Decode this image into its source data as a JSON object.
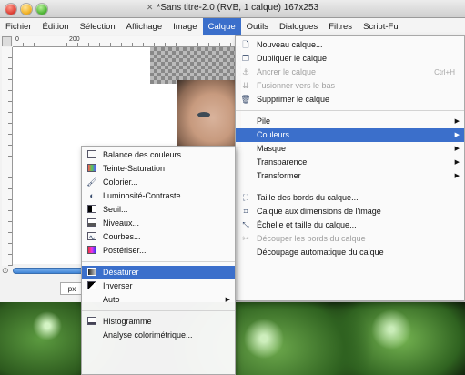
{
  "window": {
    "title": "*Sans titre-2.0 (RVB, 1 calque) 167x253",
    "title_icon": "gimp-wilber-icon"
  },
  "menubar": [
    {
      "label": "Fichier",
      "active": false
    },
    {
      "label": "Édition",
      "active": false
    },
    {
      "label": "Sélection",
      "active": false
    },
    {
      "label": "Affichage",
      "active": false
    },
    {
      "label": "Image",
      "active": false
    },
    {
      "label": "Calque",
      "active": true
    },
    {
      "label": "Outils",
      "active": false
    },
    {
      "label": "Dialogues",
      "active": false
    },
    {
      "label": "Filtres",
      "active": false
    },
    {
      "label": "Script-Fu",
      "active": false
    }
  ],
  "ruler": {
    "h_labels": [
      "0",
      "200"
    ]
  },
  "unit_selector": "px",
  "calque_menu": {
    "items": [
      {
        "label": "Nouveau calque...",
        "icon": "new-layer-icon",
        "disabled": false
      },
      {
        "label": "Dupliquer le calque",
        "icon": "duplicate-layer-icon",
        "disabled": false
      },
      {
        "label": "Ancrer le calque",
        "icon": "anchor-icon",
        "disabled": true,
        "shortcut": "Ctrl+H"
      },
      {
        "label": "Fusionner vers le bas",
        "icon": "merge-down-icon",
        "disabled": true
      },
      {
        "label": "Supprimer le calque",
        "icon": "delete-layer-icon",
        "disabled": false
      },
      {
        "separator": true
      },
      {
        "label": "Pile",
        "submenu": true
      },
      {
        "label": "Couleurs",
        "submenu": true,
        "highlight": true
      },
      {
        "label": "Masque",
        "submenu": true
      },
      {
        "label": "Transparence",
        "submenu": true
      },
      {
        "label": "Transformer",
        "submenu": true
      },
      {
        "separator": true
      },
      {
        "label": "Taille des bords du calque...",
        "icon": "layer-boundary-icon"
      },
      {
        "label": "Calque aux dimensions de l'image",
        "icon": "layer-to-image-size-icon"
      },
      {
        "label": "Échelle et taille du calque...",
        "icon": "scale-layer-icon"
      },
      {
        "label": "Découper les bords du calque",
        "icon": "crop-icon",
        "disabled": true
      },
      {
        "label": "Découpage automatique du calque"
      }
    ]
  },
  "couleurs_menu": {
    "items": [
      {
        "label": "Balance des couleurs...",
        "icon": "color-balance-icon"
      },
      {
        "label": "Teinte-Saturation",
        "icon": "hue-saturation-icon"
      },
      {
        "label": "Colorier...",
        "icon": "colorize-icon"
      },
      {
        "label": "Luminosité-Contraste...",
        "icon": "brightness-contrast-icon"
      },
      {
        "label": "Seuil...",
        "icon": "threshold-icon"
      },
      {
        "label": "Niveaux...",
        "icon": "levels-icon"
      },
      {
        "label": "Courbes...",
        "icon": "curves-icon"
      },
      {
        "label": "Postériser...",
        "icon": "posterize-icon"
      },
      {
        "separator": true
      },
      {
        "label": "Désaturer",
        "icon": "desaturate-icon",
        "highlight": true
      },
      {
        "label": "Inverser",
        "icon": "invert-icon"
      },
      {
        "label": "Auto",
        "submenu": true
      },
      {
        "separator": true
      },
      {
        "label": "Histogramme",
        "icon": "histogram-icon"
      },
      {
        "label": "Analyse colorimétrique..."
      }
    ]
  },
  "colors": {
    "highlight": "#3b6fcb",
    "disabled_text": "#a0a0a0"
  }
}
